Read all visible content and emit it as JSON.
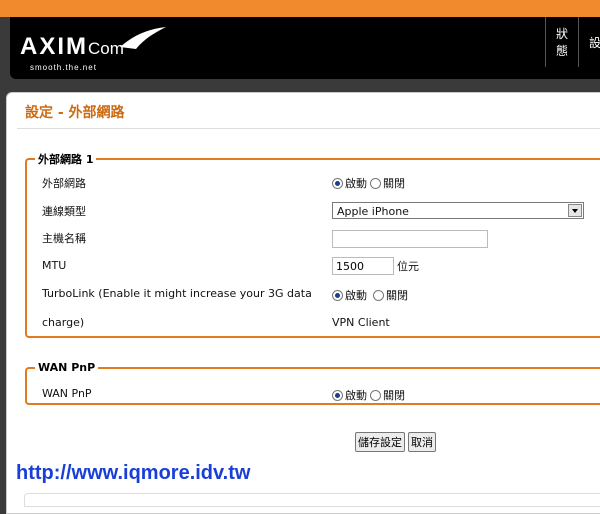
{
  "brand": {
    "name": "AXIM",
    "suffix": "Com",
    "tagline": "smooth.the.net"
  },
  "nav": {
    "items": [
      {
        "label": "狀態"
      },
      {
        "label": "設"
      }
    ]
  },
  "page": {
    "title": "設定 - 外部網路"
  },
  "wan": {
    "legend": "外部網路 1",
    "rows": {
      "wan": {
        "label": "外部網路",
        "on": "啟動",
        "off": "關閉",
        "selected": "啟動"
      },
      "conn_type": {
        "label": "連線類型",
        "value": "Apple iPhone"
      },
      "hostname": {
        "label": "主機名稱",
        "value": ""
      },
      "mtu": {
        "label": "MTU",
        "value": "1500",
        "unit": "位元"
      },
      "turbolink": {
        "label_line1": "TurboLink (Enable it might increase your 3G data",
        "label_line2": "charge)",
        "on": "啟動",
        "off": "關閉",
        "selected": "啟動",
        "extra": "VPN Client"
      }
    }
  },
  "pnp": {
    "legend": "WAN PnP",
    "row": {
      "label": "WAN PnP",
      "on": "啟動",
      "off": "關閉",
      "selected": "啟動"
    }
  },
  "buttons": {
    "save": "儲存設定",
    "cancel": "取消"
  },
  "watermark": "http://www.iqmore.idv.tw",
  "colors": {
    "accent": "#f08a2c",
    "title": "#cc6b12",
    "watermark": "#1a3fd6"
  }
}
